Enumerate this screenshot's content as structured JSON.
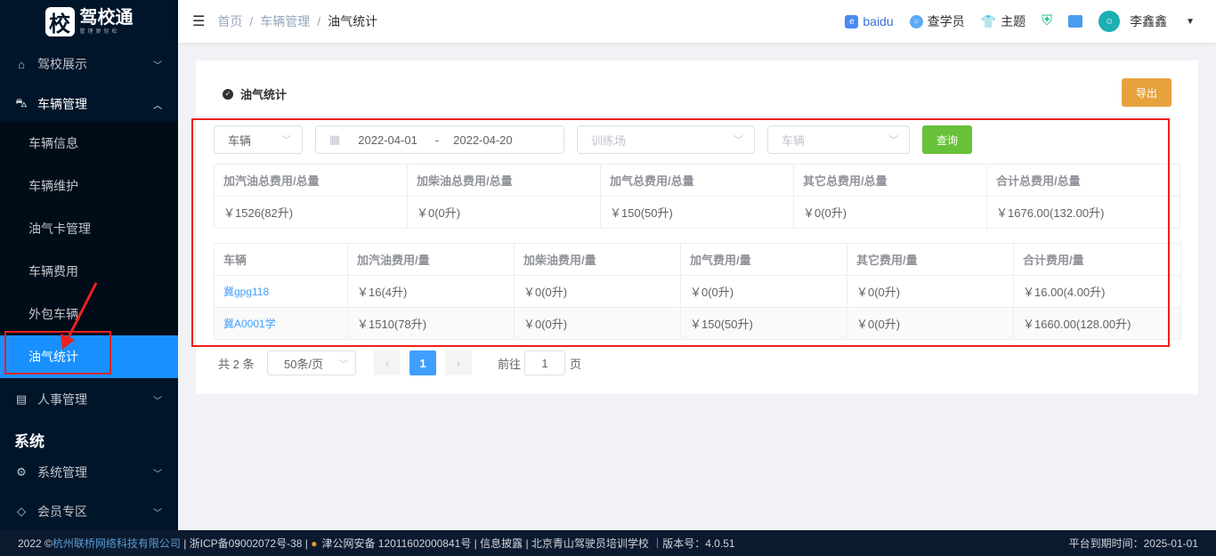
{
  "logo": {
    "icon_char": "校",
    "title": "驾校通",
    "subtitle": "管理更轻松"
  },
  "sidebar": {
    "menus": [
      {
        "label": "驾校展示",
        "icon": "home-icon"
      },
      {
        "label": "车辆管理",
        "icon": "car-icon"
      },
      {
        "label": "人事管理",
        "icon": "id-card-icon"
      },
      {
        "label": "系统管理",
        "icon": "gear-icon"
      },
      {
        "label": "会员专区",
        "icon": "diamond-icon"
      }
    ],
    "sub_items": [
      "车辆信息",
      "车辆维护",
      "油气卡管理",
      "车辆费用",
      "外包车辆",
      "油气统计"
    ],
    "section": "系统"
  },
  "header": {
    "breadcrumb": [
      "首页",
      "车辆管理",
      "油气统计"
    ],
    "baidu": "baidu",
    "search_student": "查学员",
    "theme": "主题",
    "user": "李鑫鑫"
  },
  "card": {
    "title": "油气统计",
    "export": "导出"
  },
  "filters": {
    "type_select": "车辆",
    "date_start": "2022-04-01",
    "date_sep": "-",
    "date_end": "2022-04-20",
    "field_placeholder": "训练场",
    "vehicle_placeholder": "车辆",
    "query": "查询"
  },
  "summary": {
    "headers": [
      "加汽油总费用/总量",
      "加柴油总费用/总量",
      "加气总费用/总量",
      "其它总费用/总量",
      "合计总费用/总量"
    ],
    "values": [
      "￥1526(82升)",
      "￥0(0升)",
      "￥150(50升)",
      "￥0(0升)",
      "￥1676.00(132.00升)"
    ]
  },
  "detail": {
    "headers": [
      "车辆",
      "加汽油费用/量",
      "加柴油费用/量",
      "加气费用/量",
      "其它费用/量",
      "合计费用/量"
    ],
    "rows": [
      [
        "冀gpg118",
        "￥16(4升)",
        "￥0(0升)",
        "￥0(0升)",
        "￥0(0升)",
        "￥16.00(4.00升)"
      ],
      [
        "冀A0001学",
        "￥1510(78升)",
        "￥0(0升)",
        "￥150(50升)",
        "￥0(0升)",
        "￥1660.00(128.00升)"
      ]
    ]
  },
  "pagination": {
    "total": "共 2 条",
    "page_size": "50条/页",
    "current": "1",
    "goto_label": "前往",
    "goto_value": "1",
    "page_unit": "页"
  },
  "footer": {
    "year": "2022 ©",
    "company": "杭州联桥网络科技有限公司",
    "icp": " | 浙ICP备09002072号-38 | ",
    "police": "津公网安备 12011602000841号 | 信息披露 | 北京青山驾驶员培训学校 ｜版本号：4.0.51",
    "expire": "平台到期时间：2025-01-01"
  }
}
